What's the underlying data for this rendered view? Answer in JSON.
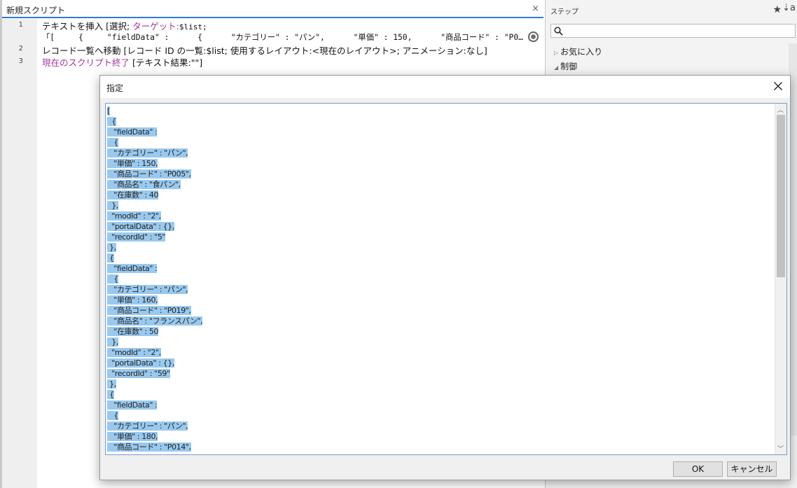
{
  "editor": {
    "tab_title": "新規スクリプト",
    "close_glyph": "×",
    "lines": [
      {
        "num": "1",
        "text_a": "テキストを挿入 [選択; ",
        "text_b": "ターゲット:",
        "text_c": "$list;"
      },
      {
        "text": "「[     {     \"fieldData\" :      {      \"カテゴリー\" : \"パン\",      \"単価\" : 150,      \"商品コード\" : \"P0… ]"
      },
      {
        "num": "2",
        "text": "レコード一覧へ移動 [レコード ID の一覧:$list; 使用するレイアウト:<現在のレイアウト>; アニメーション:なし]"
      },
      {
        "num": "3",
        "text_a": "現在のスクリプト終了",
        "text_b": " [テキスト結果:\"\"]"
      }
    ]
  },
  "steps_panel": {
    "header": "ステップ",
    "star_glyph": "★",
    "sort_glyph": "⇣a",
    "search_placeholder": "",
    "categories": [
      {
        "label": "お気に入り",
        "expanded": false
      },
      {
        "label": "制御",
        "expanded": true
      }
    ]
  },
  "dialog": {
    "title": "指定",
    "ok_label": "OK",
    "cancel_label": "キャンセル",
    "content_lines": [
      "[",
      "  {",
      "   \"fieldData\" :",
      "   {",
      "   \"カテゴリー\" : \"パン\",",
      "   \"単価\" : 150,",
      "   \"商品コード\" : \"P005\",",
      "   \"商品名\" : \"食パン\",",
      "   \"在庫数\" : 40",
      "  },",
      "  \"modId\" : \"2\",",
      "  \"portalData\" : {},",
      "  \"recordId\" : \"5\"",
      " },",
      " {",
      "   \"fieldData\" :",
      "   {",
      "   \"カテゴリー\" : \"パン\",",
      "   \"単価\" : 160,",
      "   \"商品コード\" : \"P019\",",
      "   \"商品名\" : \"フランスパン\",",
      "   \"在庫数\" : 50",
      "  },",
      "  \"modId\" : \"2\",",
      "  \"portalData\" : {},",
      "  \"recordId\" : \"59\"",
      " },",
      " {",
      "   \"fieldData\" :",
      "   {",
      "   \"カテゴリー\" : \"パン\",",
      "   \"単価\" : 180,",
      "   \"商品コード\" : \"P014\","
    ]
  },
  "colors": {
    "selection": "#99c9ef",
    "tab_accent": "#2c7cd6",
    "keyword_purple": "#a0369c"
  }
}
